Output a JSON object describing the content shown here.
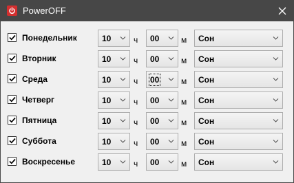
{
  "window": {
    "title": "PowerOFF",
    "accent_color": "#d32f2f",
    "titlebar_color": "#474747"
  },
  "labels": {
    "hour_unit": "ч",
    "minute_unit": "м"
  },
  "rows": [
    {
      "day": "Понедельник",
      "checked": true,
      "hour": "10",
      "minute": "00",
      "mode": "Сон"
    },
    {
      "day": "Вторник",
      "checked": true,
      "hour": "10",
      "minute": "00",
      "mode": "Сон"
    },
    {
      "day": "Среда",
      "checked": true,
      "hour": "10",
      "minute": "00",
      "mode": "Сон",
      "minute_focused": true
    },
    {
      "day": "Четверг",
      "checked": true,
      "hour": "10",
      "minute": "00",
      "mode": "Сон"
    },
    {
      "day": "Пятница",
      "checked": true,
      "hour": "10",
      "minute": "00",
      "mode": "Сон"
    },
    {
      "day": "Суббота",
      "checked": true,
      "hour": "10",
      "minute": "00",
      "mode": "Сон"
    },
    {
      "day": "Воскресенье",
      "checked": true,
      "hour": "10",
      "minute": "00",
      "mode": "Сон"
    }
  ]
}
